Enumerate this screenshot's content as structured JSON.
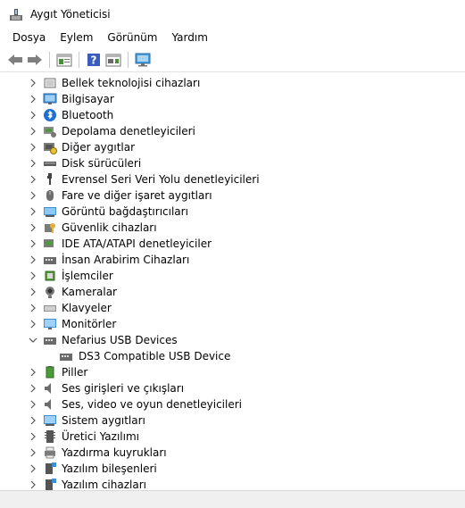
{
  "window": {
    "title": "Aygıt Yöneticisi"
  },
  "menu": [
    {
      "label": "Dosya"
    },
    {
      "label": "Eylem"
    },
    {
      "label": "Görünüm"
    },
    {
      "label": "Yardım"
    }
  ],
  "toolbar": {
    "buttons": [
      "back-icon",
      "forward-icon",
      "properties-icon",
      "help-icon",
      "update-driver-icon",
      "computer-monitor-icon"
    ]
  },
  "tree": [
    {
      "label": "Bellek teknolojisi cihazları",
      "icon": "memory-device-icon",
      "expanded": false
    },
    {
      "label": "Bilgisayar",
      "icon": "computer-icon",
      "expanded": false
    },
    {
      "label": "Bluetooth",
      "icon": "bluetooth-icon",
      "expanded": false
    },
    {
      "label": "Depolama denetleyicileri",
      "icon": "storage-controller-icon",
      "expanded": false
    },
    {
      "label": "Diğer aygıtlar",
      "icon": "other-devices-icon",
      "expanded": false
    },
    {
      "label": "Disk sürücüleri",
      "icon": "disk-drive-icon",
      "expanded": false
    },
    {
      "label": "Evrensel Seri Veri Yolu denetleyicileri",
      "icon": "usb-controller-icon",
      "expanded": false
    },
    {
      "label": "Fare ve diğer işaret aygıtları",
      "icon": "mouse-icon",
      "expanded": false
    },
    {
      "label": "Görüntü bağdaştırıcıları",
      "icon": "display-adapter-icon",
      "expanded": false
    },
    {
      "label": "Güvenlik cihazları",
      "icon": "security-device-icon",
      "expanded": false
    },
    {
      "label": "IDE ATA/ATAPI denetleyiciler",
      "icon": "ide-controller-icon",
      "expanded": false
    },
    {
      "label": "İnsan Arabirim Cihazları",
      "icon": "hid-icon",
      "expanded": false
    },
    {
      "label": "İşlemciler",
      "icon": "processor-icon",
      "expanded": false
    },
    {
      "label": "Kameralar",
      "icon": "camera-icon",
      "expanded": false
    },
    {
      "label": "Klavyeler",
      "icon": "keyboard-icon",
      "expanded": false
    },
    {
      "label": "Monitörler",
      "icon": "monitor-icon",
      "expanded": false
    },
    {
      "label": "Nefarius USB Devices",
      "icon": "usb-device-category-icon",
      "expanded": true,
      "children": [
        {
          "label": "DS3 Compatible USB Device",
          "icon": "usb-device-icon"
        }
      ]
    },
    {
      "label": "Piller",
      "icon": "battery-icon",
      "expanded": false
    },
    {
      "label": "Ses girişleri ve çıkışları",
      "icon": "audio-io-icon",
      "expanded": false
    },
    {
      "label": "Ses, video ve oyun denetleyicileri",
      "icon": "sound-video-icon",
      "expanded": false
    },
    {
      "label": "Sistem aygıtları",
      "icon": "system-devices-icon",
      "expanded": false
    },
    {
      "label": "Üretici Yazılımı",
      "icon": "firmware-icon",
      "expanded": false
    },
    {
      "label": "Yazdırma kuyrukları",
      "icon": "print-queue-icon",
      "expanded": false
    },
    {
      "label": "Yazılım bileşenleri",
      "icon": "software-component-icon",
      "expanded": false
    },
    {
      "label": "Yazılım cihazları",
      "icon": "software-device-icon",
      "expanded": false
    }
  ]
}
